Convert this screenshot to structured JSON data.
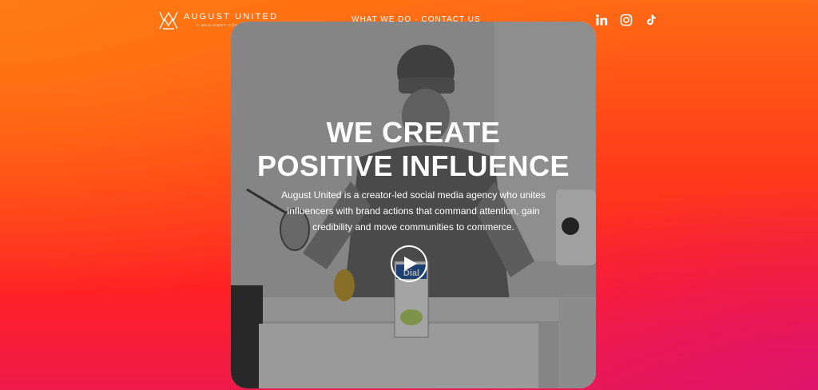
{
  "header": {
    "logo_name": "AUGUST UNITED",
    "logo_sub": "A MCKINNEY COMPANY",
    "nav": [
      {
        "label": "WHAT WE DO"
      },
      {
        "label": "·"
      },
      {
        "label": "CONTACT US"
      }
    ],
    "social": [
      {
        "icon": "linkedin-icon"
      },
      {
        "icon": "instagram-icon"
      },
      {
        "icon": "tiktok-icon"
      }
    ]
  },
  "hero": {
    "title_line1": "WE CREATE",
    "title_line2": "POSITIVE INFLUENCE",
    "description": "August United is a creator-led social media agency who unites influencers with brand actions that command attention, gain credibility and move communities to commerce.",
    "play_icon": "play-icon",
    "product_label": "Dial"
  },
  "colors": {
    "background_top": "#ff6a14",
    "background_mid": "#ff2026",
    "background_corner": "#e0156a",
    "text": "#ffffff"
  }
}
